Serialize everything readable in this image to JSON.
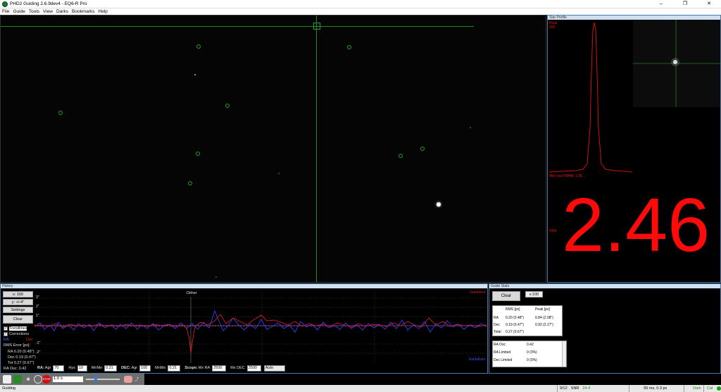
{
  "window": {
    "title": "PHD2 Guiding 2.6.9dev4 - EQ6-R Pro",
    "minimize": "–",
    "maximize": "❐",
    "close": "✕"
  },
  "menu": [
    "File",
    "Guide",
    "Tools",
    "View",
    "Darks",
    "Bookmarks",
    "Help"
  ],
  "star_profile": {
    "header": "Star Profile",
    "peak_label": "Peak",
    "peak_value": "255",
    "fwhm_label": "Mid row FWHM: 1.88",
    "hfd_label": "HFD:",
    "hfd_value": "2.46"
  },
  "history": {
    "header": "History",
    "x_btn": "x: 100",
    "y_btn": "y: +/-4\"",
    "settings_btn": "Settings",
    "clear_btn": "Clear",
    "trendlines": "Trendlines",
    "corrections": "Corrections",
    "ra_label": "RA",
    "dec_label": "Dec",
    "rms_title": "RMS Error [px]:",
    "rms_ra": "RA 0.20 (0.48\")",
    "rms_dec": "Dec 0.19 (0.47\")",
    "rms_tot": "Tot 0.27 (0.67\")",
    "ra_osc": "RA Osc: 0.42",
    "y_ticks": [
      "3\"",
      "2\"",
      "1\"",
      "",
      "-1\"",
      "-2\""
    ],
    "dither_label": "Dither",
    "legend_top": "Guidefoot",
    "legend_bottom": "GuideEast",
    "controls": {
      "ra": "RA:",
      "agr": "Agr",
      "agr_val": "70",
      "hys": "Hys",
      "hys_val": "10",
      "mnmo": "MnMo",
      "mnmo_val": "0.21",
      "dec": "DEC:",
      "dec_agr": "Agr",
      "dec_agr_val": "100",
      "dec_mnmo": "MnMo",
      "dec_mnmo_val": "0.21",
      "scope": "Scope:",
      "mxra": "Mx RA",
      "mxra_val": "2500",
      "mxdec": "Mx DEC",
      "mxdec_val": "2500",
      "mode": "Auto"
    }
  },
  "guide_stats": {
    "header": "Guide Stats",
    "clear_btn": "Clear",
    "x_select": "x:100",
    "col_rms": "RMS [px]",
    "col_peak": "Peak [px]",
    "rows": [
      {
        "name": "RA",
        "rms": "0.20 (0.48\")",
        "peak": "0.84 (2.08\")"
      },
      {
        "name": "Dec",
        "rms": "0.19 (0.47\")",
        "peak": "0.92 (2.27\")"
      },
      {
        "name": "Total",
        "rms": "0.27 (0.67\")",
        "peak": ""
      }
    ],
    "extra": [
      {
        "name": "RA Osc",
        "value": "0.42"
      },
      {
        "name": "RA Limited",
        "value": "0 (0%)"
      },
      {
        "name": "Dec Limited",
        "value": "0 (0%)"
      }
    ]
  },
  "toolbar": {
    "exposure": "1.0 s"
  },
  "status": {
    "left": "Guiding",
    "frames": "9/12",
    "snr_label": "SNR",
    "snr_value": "24.4",
    "exposure": "55 ms, 0.3 px",
    "dark": "Dark",
    "cal": "Cal"
  }
}
